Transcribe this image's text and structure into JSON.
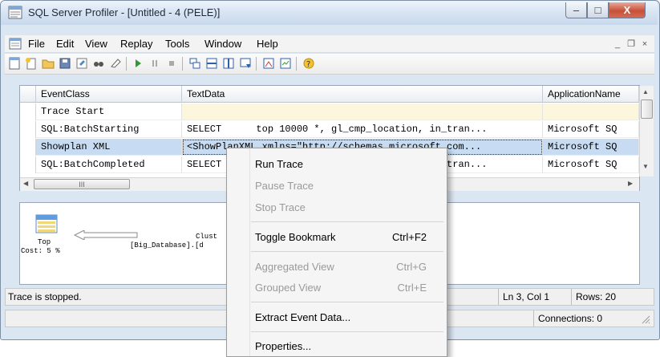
{
  "window": {
    "title": "SQL Server Profiler - [Untitled - 4 (PELE)]"
  },
  "caption_buttons": {
    "minimize": "–",
    "maximize": "□",
    "close": "X"
  },
  "menubar": {
    "items": [
      "File",
      "Edit",
      "View",
      "Replay",
      "Tools",
      "Window",
      "Help"
    ],
    "mdi_minimize": "_",
    "mdi_restore": "❐",
    "mdi_close": "×"
  },
  "toolbar": {
    "icons": [
      "new-trace-icon",
      "new-template-icon",
      "open-icon",
      "save-icon",
      "properties-icon",
      "find-icon",
      "clear-icon",
      "run-icon",
      "pause-icon",
      "stop-icon",
      "aggregated-view-icon",
      "grouped-view-icon",
      "columns-icon",
      "filter-icon",
      "perfmon-icon",
      "perfmon2-icon",
      "help-icon"
    ]
  },
  "grid": {
    "columns": [
      "EventClass",
      "TextData",
      "ApplicationName"
    ],
    "rows": [
      {
        "event": "Trace Start",
        "text": "",
        "app": ""
      },
      {
        "event": "SQL:BatchStarting",
        "text": "SELECT      top 10000 *, gl_cmp_location, in_tran...",
        "app": "Microsoft SQ"
      },
      {
        "event": "Showplan XML",
        "text": "<ShowPlanXML xmlns=\"http://schemas.microsoft.com...",
        "app": "Microsoft SQ"
      },
      {
        "event": "SQL:BatchCompleted",
        "text": "SELECT      top 10000 *, gl_cmp_location, in_tran...",
        "app": "Microsoft SQ"
      }
    ],
    "hscroll_grip": "III"
  },
  "plan": {
    "node_label": "Top",
    "node_cost": "Cost: 5 %",
    "clustered_label": "Clust",
    "database_label": "[Big_Database].[d"
  },
  "status": {
    "message": "Trace is stopped.",
    "position": "Ln 3, Col 1",
    "rows": "Rows: 20",
    "connections": "Connections: 0"
  },
  "context_menu": {
    "items": [
      {
        "label": "Run Trace",
        "shortcut": "",
        "enabled": true
      },
      {
        "label": "Pause Trace",
        "shortcut": "",
        "enabled": false
      },
      {
        "label": "Stop Trace",
        "shortcut": "",
        "enabled": false
      },
      {
        "label": "Toggle Bookmark",
        "shortcut": "Ctrl+F2",
        "enabled": true
      },
      {
        "label": "Aggregated View",
        "shortcut": "Ctrl+G",
        "enabled": false
      },
      {
        "label": "Grouped View",
        "shortcut": "Ctrl+E",
        "enabled": false
      },
      {
        "label": "Extract Event Data...",
        "shortcut": "",
        "enabled": true
      },
      {
        "label": "Properties...",
        "shortcut": "",
        "enabled": true
      }
    ]
  },
  "colors": {
    "selected_row": "#c7dcf2",
    "trace_start_row": "#fbf6dc",
    "menu_disabled": "#9a9a9a"
  }
}
